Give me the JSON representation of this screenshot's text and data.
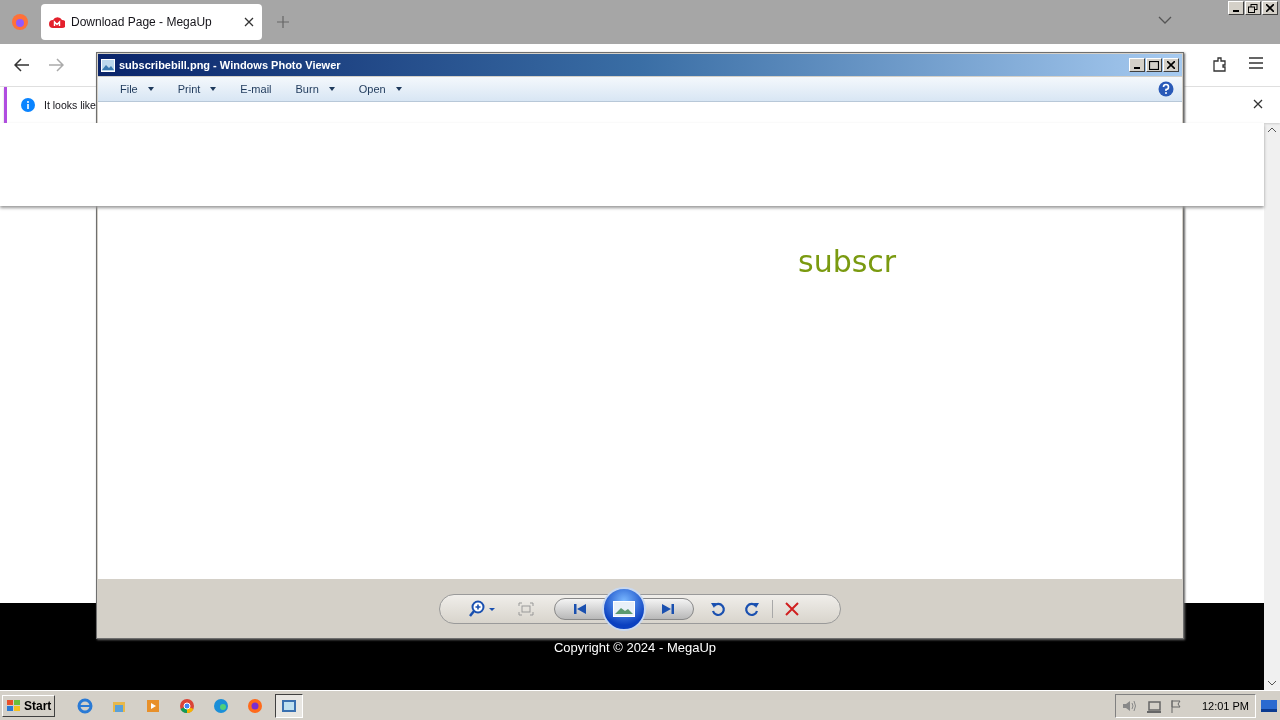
{
  "browser": {
    "tabs": [
      {
        "title": "Download Page - MegaUp",
        "selected": true
      }
    ],
    "notification": {
      "text": "It looks like"
    },
    "footer": {
      "copyright": "Copyright © 2024 - MegaUp"
    }
  },
  "photo_viewer": {
    "title": "subscribebill.png - Windows Photo Viewer",
    "menu": [
      {
        "label": "File",
        "dropdown": true
      },
      {
        "label": "Print",
        "dropdown": true
      },
      {
        "label": "E-mail",
        "dropdown": false
      },
      {
        "label": "Burn",
        "dropdown": true
      },
      {
        "label": "Open",
        "dropdown": true
      }
    ],
    "image_text": "subscr"
  },
  "taskbar": {
    "start": "Start",
    "apps": [
      {
        "kind": "ie",
        "selected": false
      },
      {
        "kind": "explorer",
        "selected": false
      },
      {
        "kind": "media",
        "selected": false
      },
      {
        "kind": "chrome",
        "selected": false
      },
      {
        "kind": "edge",
        "selected": false
      },
      {
        "kind": "firefox",
        "selected": false
      },
      {
        "kind": "photos",
        "selected": true
      }
    ],
    "clock": "12:01 PM"
  }
}
